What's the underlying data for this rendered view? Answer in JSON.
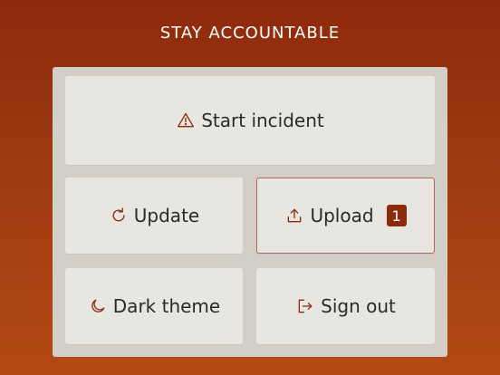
{
  "header": {
    "title": "STAY ACCOUNTABLE"
  },
  "buttons": {
    "start_incident": {
      "label": "Start incident",
      "icon": "warning-icon"
    },
    "update": {
      "label": "Update",
      "icon": "refresh-icon"
    },
    "upload": {
      "label": "Upload",
      "icon": "upload-icon",
      "badge": "1"
    },
    "dark_theme": {
      "label": "Dark theme",
      "icon": "moon-icon"
    },
    "sign_out": {
      "label": "Sign out",
      "icon": "sign-out-icon"
    }
  },
  "colors": {
    "accent": "#8e2a0c",
    "background_top": "#8e2a0c",
    "background_bottom": "#b34a14",
    "panel": "#d4cfc6",
    "button": "#e8e6e1"
  }
}
